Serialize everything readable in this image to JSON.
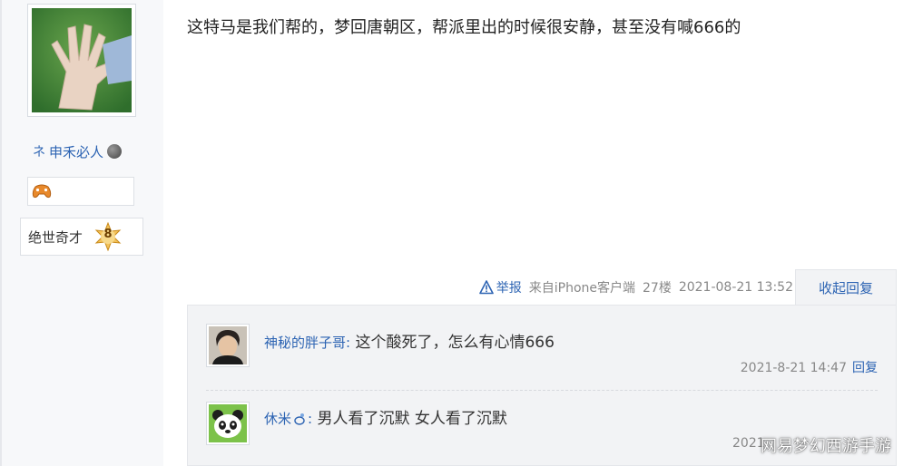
{
  "sidebar": {
    "username": "申禾必人",
    "level_title": "绝世奇才",
    "level_number": "8"
  },
  "post": {
    "content": "这特马是我们帮的，梦回唐朝区，帮派里出的时候很安静，甚至没有喊666的",
    "report_label": "举报",
    "source": "来自iPhone客户端",
    "floor": "27楼",
    "timestamp": "2021-08-21 13:52",
    "collapse_label": "收起回复"
  },
  "replies": [
    {
      "user": "神秘的胖子哥:",
      "text": " 这个酸死了，怎么有心情666",
      "time": "2021-8-21 14:47",
      "reply_label": "回复"
    },
    {
      "user": "休米",
      "text": " 男人看了沉默 女人看了沉默",
      "time": "2021",
      "reply_label": ""
    }
  ],
  "watermark": "网易梦幻西游手游",
  "colors": {
    "link": "#2d64b3",
    "meta": "#888888",
    "reply_bg": "#f2f3f5",
    "sidebar_bg": "#f7f8fa"
  },
  "icons": {
    "user_prefix": "user-mark-icon",
    "globe": "globe-icon",
    "badge": "game-controller-icon",
    "level": "star-badge-icon",
    "report": "warning-icon",
    "avatar_b": "panda-icon"
  }
}
